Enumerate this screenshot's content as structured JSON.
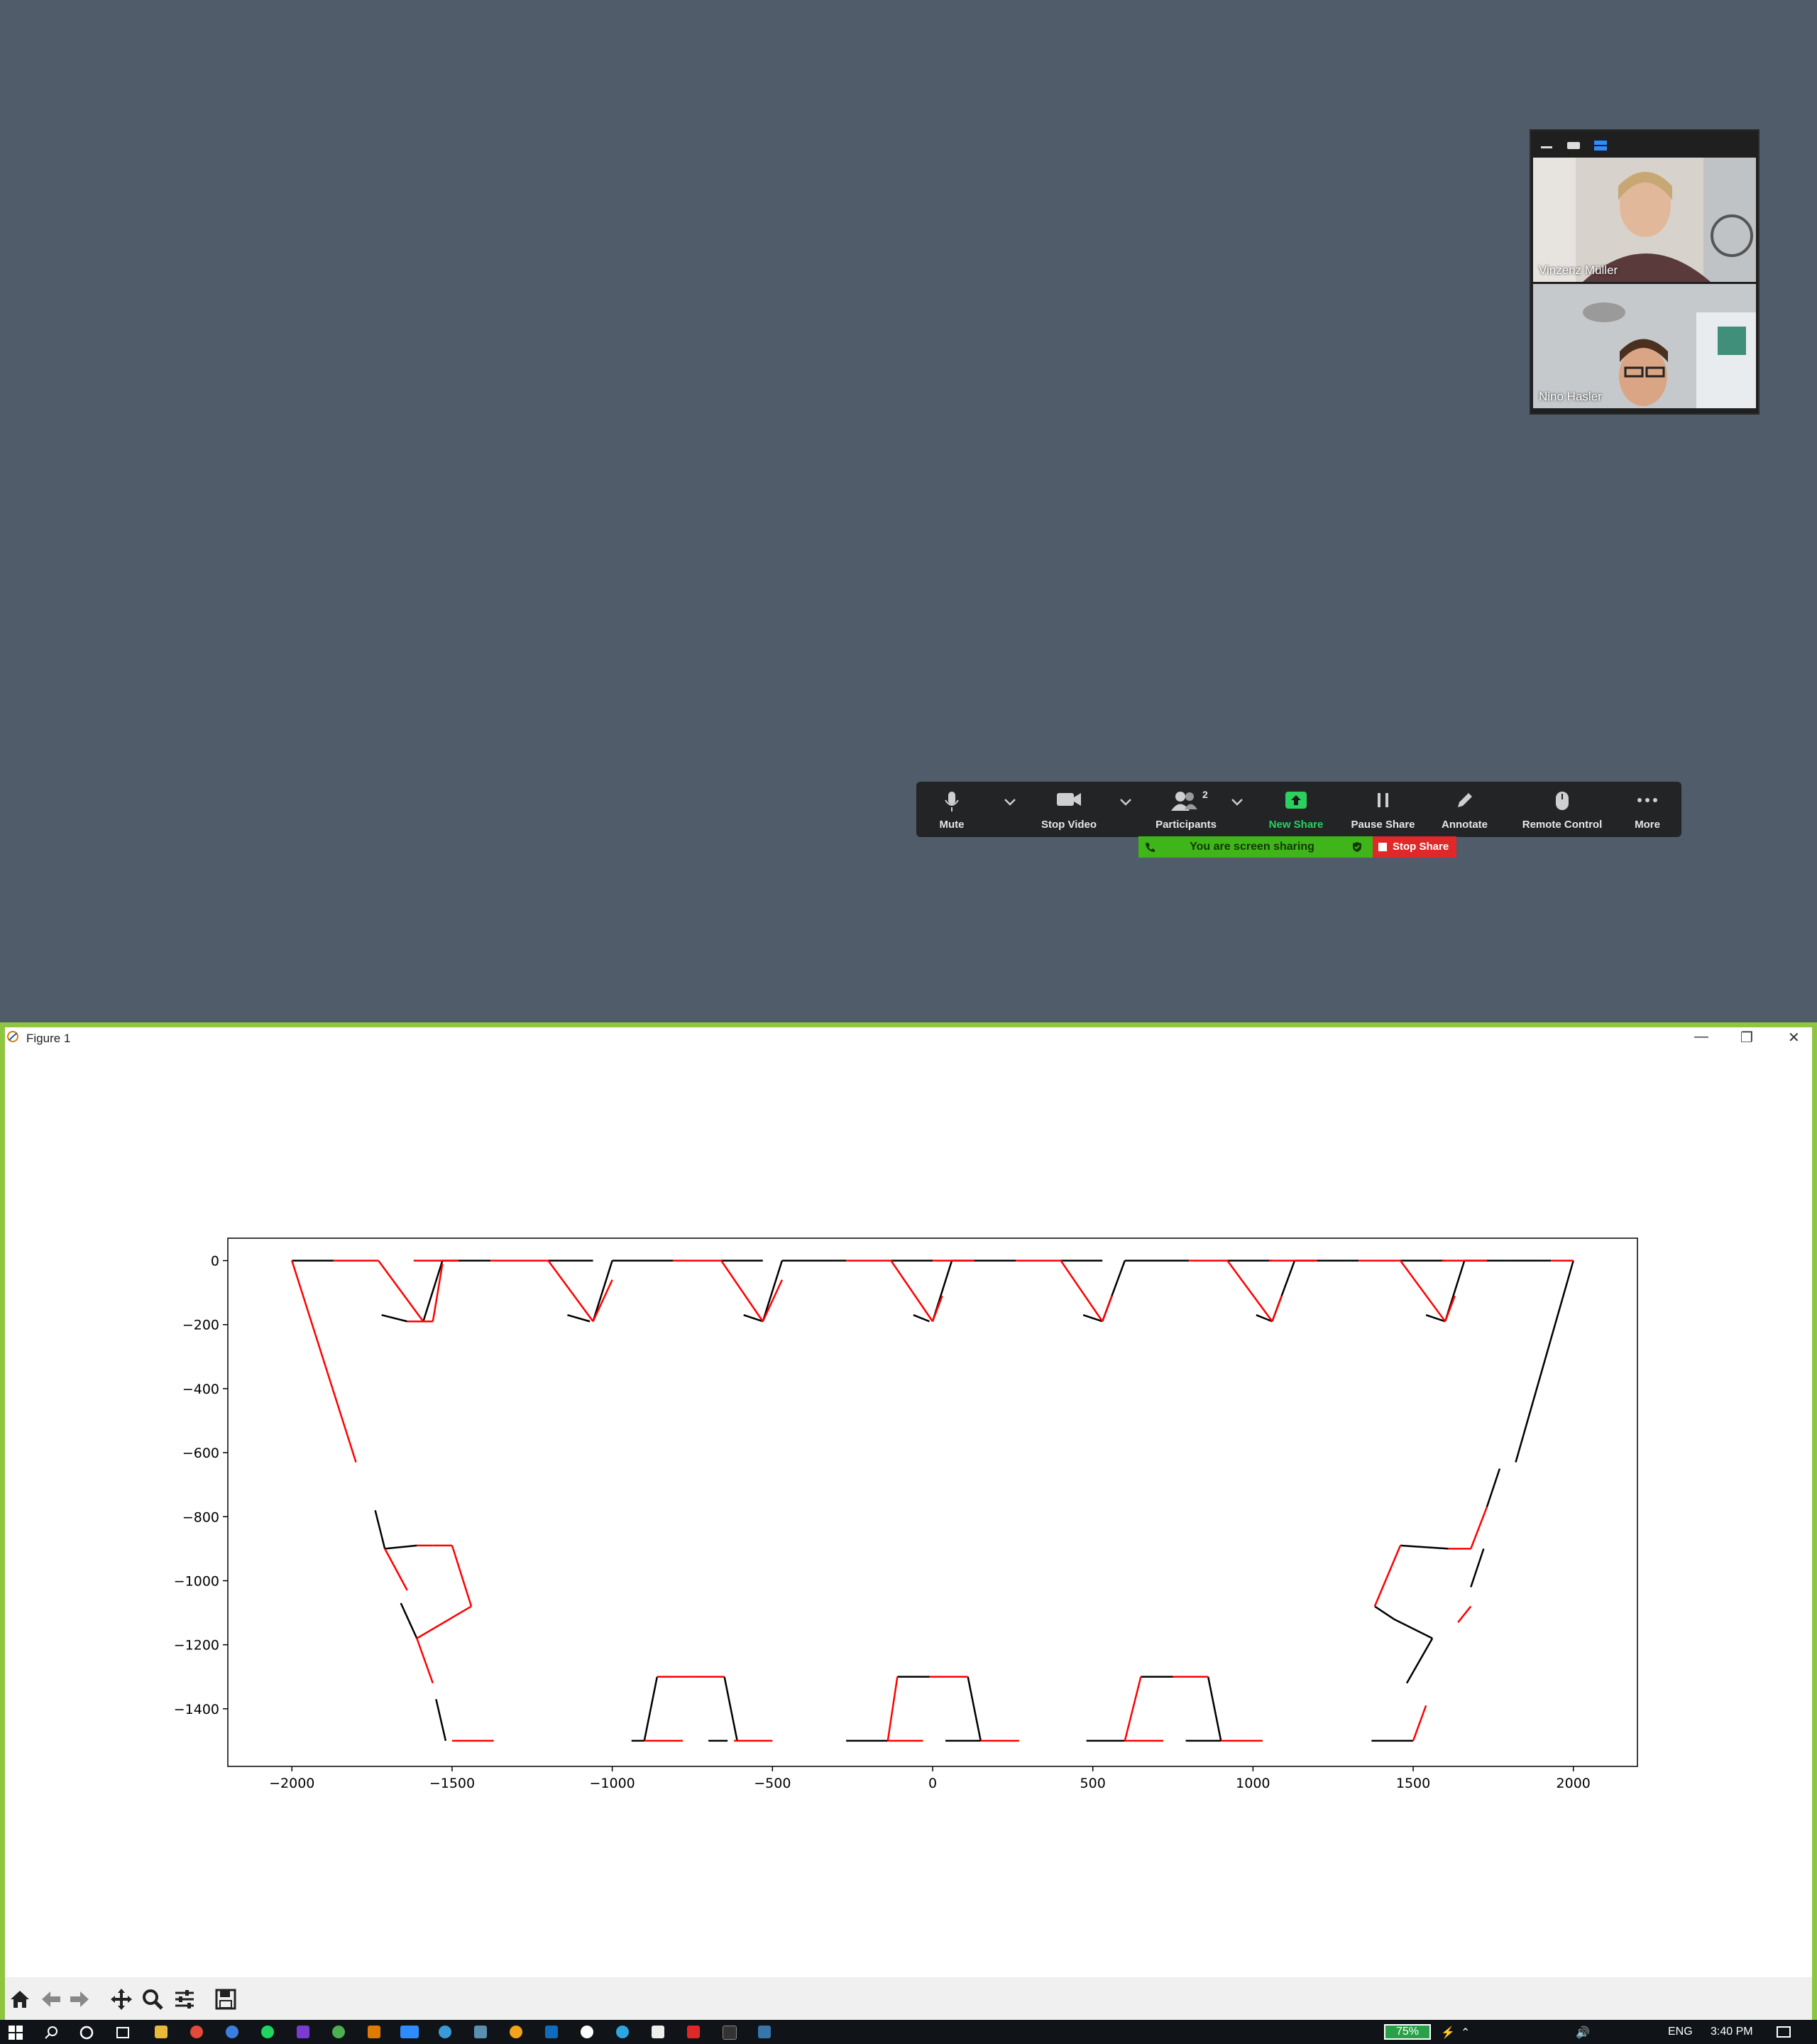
{
  "video_panel": {
    "participants": [
      {
        "name": "Vinzenz Müller"
      },
      {
        "name": "Nino Hasler"
      }
    ]
  },
  "toolbar": {
    "mute": "Mute",
    "stop_video": "Stop Video",
    "participants": "Participants",
    "participants_count": "2",
    "new_share": "New Share",
    "pause_share": "Pause Share",
    "annotate": "Annotate",
    "remote_control": "Remote Control",
    "more": "More",
    "sharing_banner": "You are screen sharing",
    "stop_share": "Stop Share",
    "colors": {
      "new_share": "#2bd05f",
      "banner": "#3fb51a",
      "stop": "#e02828"
    }
  },
  "figure_window": {
    "title": "Figure 1"
  },
  "chart_data": {
    "type": "line",
    "xticks": [
      "−2000",
      "−1500",
      "−1000",
      "−500",
      "0",
      "500",
      "1000",
      "1500",
      "2000"
    ],
    "xtick_values": [
      -2000,
      -1500,
      -1000,
      -500,
      0,
      500,
      1000,
      1500,
      2000
    ],
    "yticks": [
      "0",
      "−200",
      "−400",
      "−600",
      "−800",
      "−1000",
      "−1200",
      "−1400"
    ],
    "ytick_values": [
      0,
      -200,
      -400,
      -600,
      -800,
      -1000,
      -1200,
      -1400
    ],
    "xlim": [
      -2200,
      2200
    ],
    "ylim": [
      -1580,
      70
    ],
    "grid": false,
    "series": [
      {
        "color": "#000000",
        "segments": [
          [
            [
              -2000,
              0
            ],
            [
              -1870,
              0
            ]
          ],
          [
            [
              -1590,
              -190
            ],
            [
              -1530,
              0
            ]
          ],
          [
            [
              -1530,
              0
            ],
            [
              -1380,
              0
            ]
          ],
          [
            [
              -1200,
              0
            ],
            [
              -1060,
              0
            ]
          ],
          [
            [
              -1060,
              -190
            ],
            [
              -1000,
              0
            ]
          ],
          [
            [
              -1000,
              0
            ],
            [
              -810,
              0
            ]
          ],
          [
            [
              -660,
              0
            ],
            [
              -530,
              0
            ]
          ],
          [
            [
              -530,
              -190
            ],
            [
              -470,
              0
            ]
          ],
          [
            [
              -470,
              0
            ],
            [
              -270,
              0
            ]
          ],
          [
            [
              -130,
              0
            ],
            [
              0,
              0
            ]
          ],
          [
            [
              0,
              -190
            ],
            [
              60,
              0
            ]
          ],
          [
            [
              60,
              0
            ],
            [
              260,
              0
            ]
          ],
          [
            [
              400,
              0
            ],
            [
              530,
              0
            ]
          ],
          [
            [
              530,
              -190
            ],
            [
              600,
              0
            ]
          ],
          [
            [
              600,
              0
            ],
            [
              800,
              0
            ]
          ],
          [
            [
              920,
              0
            ],
            [
              1060,
              0
            ]
          ],
          [
            [
              1060,
              -190
            ],
            [
              1130,
              0
            ]
          ],
          [
            [
              1130,
              0
            ],
            [
              1330,
              0
            ]
          ],
          [
            [
              1460,
              0
            ],
            [
              1600,
              0
            ]
          ],
          [
            [
              1600,
              -190
            ],
            [
              1660,
              0
            ]
          ],
          [
            [
              1660,
              0
            ],
            [
              1790,
              0
            ]
          ],
          [
            [
              1790,
              0
            ],
            [
              1930,
              0
            ]
          ],
          [
            [
              -1720,
              -170
            ],
            [
              -1640,
              -190
            ]
          ],
          [
            [
              -1140,
              -170
            ],
            [
              -1070,
              -190
            ]
          ],
          [
            [
              -590,
              -170
            ],
            [
              -530,
              -190
            ]
          ],
          [
            [
              -60,
              -170
            ],
            [
              -10,
              -190
            ]
          ],
          [
            [
              470,
              -170
            ],
            [
              530,
              -190
            ]
          ],
          [
            [
              1010,
              -170
            ],
            [
              1060,
              -190
            ]
          ],
          [
            [
              1540,
              -170
            ],
            [
              1600,
              -190
            ]
          ],
          [
            [
              2000,
              0
            ],
            [
              1820,
              -630
            ]
          ],
          [
            [
              -1740,
              -780
            ],
            [
              -1710,
              -900
            ]
          ],
          [
            [
              -1710,
              -900
            ],
            [
              -1610,
              -890
            ]
          ],
          [
            [
              -1660,
              -1070
            ],
            [
              -1610,
              -1180
            ]
          ],
          [
            [
              -1550,
              -1370
            ],
            [
              -1520,
              -1500
            ]
          ],
          [
            [
              -940,
              -1500
            ],
            [
              -900,
              -1500
            ]
          ],
          [
            [
              -900,
              -1500
            ],
            [
              -860,
              -1300
            ]
          ],
          [
            [
              -700,
              -1500
            ],
            [
              -640,
              -1500
            ]
          ],
          [
            [
              -650,
              -1300
            ],
            [
              -610,
              -1500
            ]
          ],
          [
            [
              -270,
              -1500
            ],
            [
              -140,
              -1500
            ]
          ],
          [
            [
              -110,
              -1300
            ],
            [
              -10,
              -1300
            ]
          ],
          [
            [
              40,
              -1500
            ],
            [
              150,
              -1500
            ]
          ],
          [
            [
              110,
              -1300
            ],
            [
              150,
              -1500
            ]
          ],
          [
            [
              480,
              -1500
            ],
            [
              600,
              -1500
            ]
          ],
          [
            [
              650,
              -1300
            ],
            [
              750,
              -1300
            ]
          ],
          [
            [
              790,
              -1500
            ],
            [
              900,
              -1500
            ]
          ],
          [
            [
              860,
              -1300
            ],
            [
              900,
              -1500
            ]
          ],
          [
            [
              1370,
              -1500
            ],
            [
              1500,
              -1500
            ]
          ],
          [
            [
              1460,
              -890
            ],
            [
              1610,
              -900
            ]
          ],
          [
            [
              1380,
              -1080
            ],
            [
              1440,
              -1120
            ]
          ],
          [
            [
              1440,
              -1120
            ],
            [
              1560,
              -1180
            ]
          ],
          [
            [
              1560,
              -1180
            ],
            [
              1480,
              -1320
            ]
          ],
          [
            [
              1680,
              -1020
            ],
            [
              1720,
              -900
            ]
          ],
          [
            [
              1730,
              -770
            ],
            [
              1770,
              -650
            ]
          ]
        ]
      },
      {
        "color": "#ff0000",
        "segments": [
          [
            [
              -2000,
              0
            ],
            [
              -1800,
              -630
            ]
          ],
          [
            [
              -1870,
              0
            ],
            [
              -1730,
              0
            ]
          ],
          [
            [
              -1730,
              0
            ],
            [
              -1590,
              -190
            ]
          ],
          [
            [
              -1640,
              -190
            ],
            [
              -1560,
              -190
            ]
          ],
          [
            [
              -1560,
              -190
            ],
            [
              -1530,
              -10
            ]
          ],
          [
            [
              -1620,
              0
            ],
            [
              -1480,
              0
            ]
          ],
          [
            [
              -1380,
              0
            ],
            [
              -1200,
              0
            ]
          ],
          [
            [
              -1200,
              0
            ],
            [
              -1060,
              -190
            ]
          ],
          [
            [
              -1060,
              -190
            ],
            [
              -1000,
              -60
            ]
          ],
          [
            [
              -810,
              0
            ],
            [
              -660,
              0
            ]
          ],
          [
            [
              -660,
              0
            ],
            [
              -530,
              -190
            ]
          ],
          [
            [
              -530,
              -190
            ],
            [
              -470,
              -60
            ]
          ],
          [
            [
              -270,
              0
            ],
            [
              -130,
              0
            ]
          ],
          [
            [
              -130,
              0
            ],
            [
              0,
              -190
            ]
          ],
          [
            [
              0,
              -190
            ],
            [
              30,
              -110
            ]
          ],
          [
            [
              0,
              0
            ],
            [
              130,
              0
            ]
          ],
          [
            [
              260,
              0
            ],
            [
              400,
              0
            ]
          ],
          [
            [
              400,
              0
            ],
            [
              530,
              -190
            ]
          ],
          [
            [
              530,
              -190
            ],
            [
              560,
              -110
            ]
          ],
          [
            [
              800,
              0
            ],
            [
              920,
              0
            ]
          ],
          [
            [
              920,
              0
            ],
            [
              1060,
              -190
            ]
          ],
          [
            [
              1060,
              -190
            ],
            [
              1090,
              -110
            ]
          ],
          [
            [
              1050,
              0
            ],
            [
              1200,
              0
            ]
          ],
          [
            [
              1330,
              0
            ],
            [
              1460,
              0
            ]
          ],
          [
            [
              1460,
              0
            ],
            [
              1600,
              -190
            ]
          ],
          [
            [
              1600,
              -190
            ],
            [
              1630,
              -110
            ]
          ],
          [
            [
              1590,
              0
            ],
            [
              1730,
              0
            ]
          ],
          [
            [
              1930,
              0
            ],
            [
              2000,
              0
            ]
          ],
          [
            [
              -1710,
              -900
            ],
            [
              -1640,
              -1030
            ]
          ],
          [
            [
              -1610,
              -890
            ],
            [
              -1560,
              -890
            ]
          ],
          [
            [
              -1560,
              -890
            ],
            [
              -1500,
              -890
            ]
          ],
          [
            [
              -1500,
              -890
            ],
            [
              -1440,
              -1080
            ]
          ],
          [
            [
              -1440,
              -1080
            ],
            [
              -1610,
              -1180
            ]
          ],
          [
            [
              -1610,
              -1180
            ],
            [
              -1560,
              -1320
            ]
          ],
          [
            [
              -1500,
              -1500
            ],
            [
              -1370,
              -1500
            ]
          ],
          [
            [
              -900,
              -1500
            ],
            [
              -780,
              -1500
            ]
          ],
          [
            [
              -860,
              -1300
            ],
            [
              -760,
              -1300
            ]
          ],
          [
            [
              -760,
              -1300
            ],
            [
              -650,
              -1300
            ]
          ],
          [
            [
              -620,
              -1500
            ],
            [
              -500,
              -1500
            ]
          ],
          [
            [
              -140,
              -1500
            ],
            [
              -30,
              -1500
            ]
          ],
          [
            [
              -140,
              -1500
            ],
            [
              -110,
              -1300
            ]
          ],
          [
            [
              -10,
              -1300
            ],
            [
              110,
              -1300
            ]
          ],
          [
            [
              150,
              -1500
            ],
            [
              270,
              -1500
            ]
          ],
          [
            [
              600,
              -1500
            ],
            [
              720,
              -1500
            ]
          ],
          [
            [
              600,
              -1500
            ],
            [
              650,
              -1300
            ]
          ],
          [
            [
              750,
              -1300
            ],
            [
              860,
              -1300
            ]
          ],
          [
            [
              900,
              -1500
            ],
            [
              1030,
              -1500
            ]
          ],
          [
            [
              1500,
              -1500
            ],
            [
              1540,
              -1390
            ]
          ],
          [
            [
              1380,
              -1080
            ],
            [
              1460,
              -890
            ]
          ],
          [
            [
              1610,
              -900
            ],
            [
              1680,
              -900
            ]
          ],
          [
            [
              1680,
              -900
            ],
            [
              1730,
              -770
            ]
          ],
          [
            [
              1640,
              -1130
            ],
            [
              1680,
              -1080
            ]
          ]
        ]
      }
    ]
  }
}
